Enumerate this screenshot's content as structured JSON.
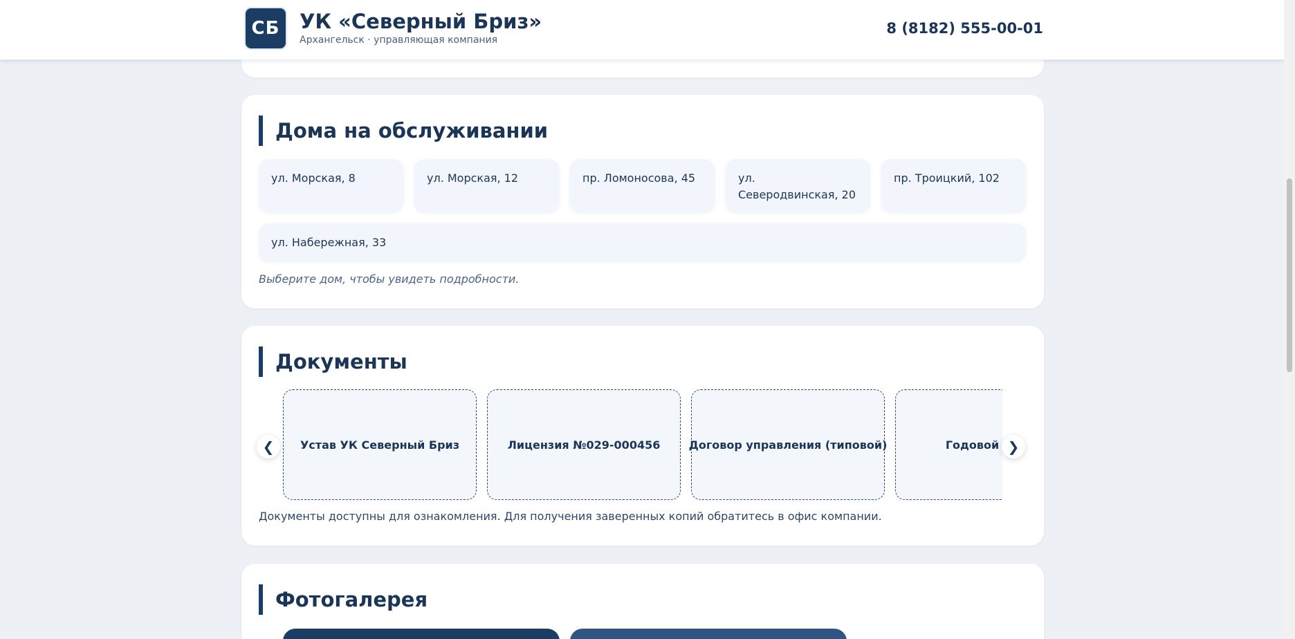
{
  "header": {
    "logo_text": "СБ",
    "title": "УК «Северный Бриз»",
    "subtitle": "Архангельск · управляющая компания",
    "phone": "8 (8182) 555-00-01"
  },
  "houses": {
    "title": "Дома на обслуживании",
    "items": [
      "ул. Морская, 8",
      "ул. Морская, 12",
      "пр. Ломоносова, 45",
      "ул. Северодвинская, 20",
      "пр. Троицкий, 102",
      "ул. Набережная, 33"
    ],
    "hint": "Выберите дом, чтобы увидеть подробности."
  },
  "documents": {
    "title": "Документы",
    "prev_label": "❮",
    "next_label": "❯",
    "items": [
      "Устав УК Северный Бриз",
      "Лицензия №029-000456",
      "Договор управления (типовой)",
      "Годовой отчёт"
    ],
    "note": "Документы доступны для ознакомления. Для получения заверенных копий обратитесь в офис компании."
  },
  "gallery": {
    "title": "Фотогалерея"
  }
}
